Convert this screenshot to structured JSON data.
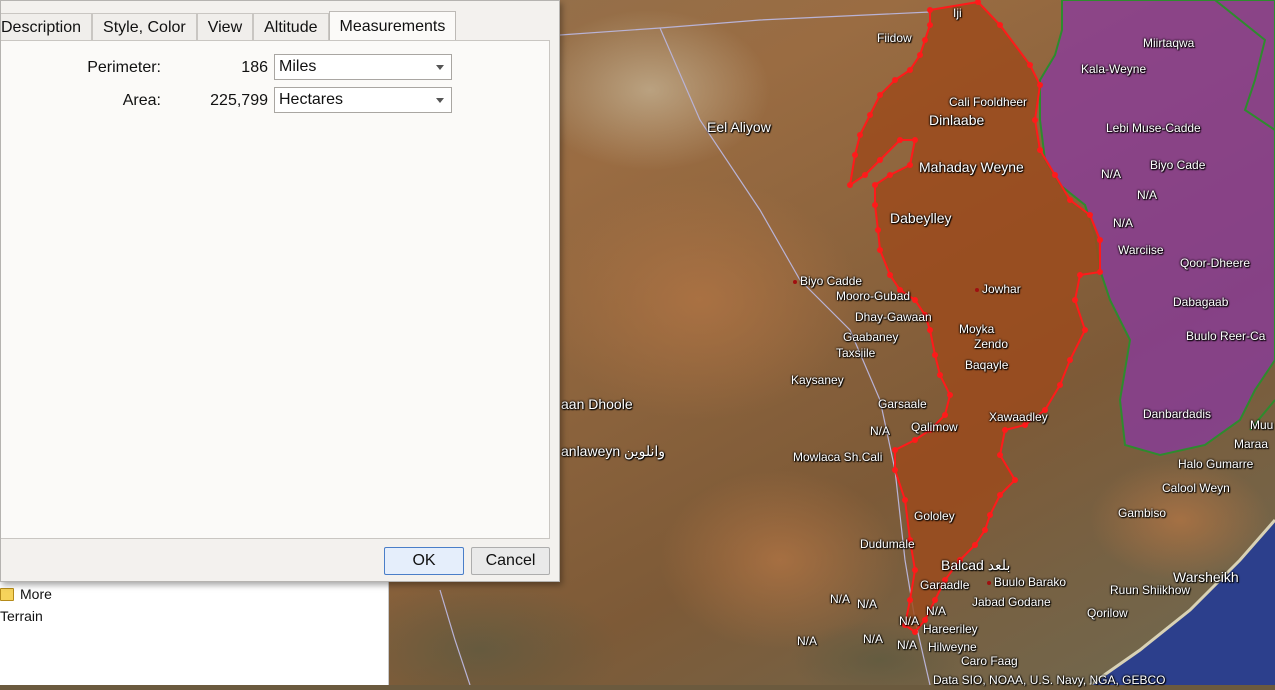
{
  "dialog": {
    "tabs": [
      {
        "label": "Description"
      },
      {
        "label": "Style, Color"
      },
      {
        "label": "View"
      },
      {
        "label": "Altitude"
      },
      {
        "label": "Measurements",
        "active": true
      }
    ],
    "measurements": {
      "perimeter": {
        "label": "Perimeter:",
        "value": "186",
        "unit": "Miles"
      },
      "area": {
        "label": "Area:",
        "value": "225,799",
        "unit": "Hectares"
      }
    },
    "ok_label": "OK",
    "cancel_label": "Cancel"
  },
  "sidebar": {
    "items": [
      {
        "label": "More",
        "icon": "folder-icon"
      },
      {
        "label": "Terrain"
      }
    ]
  },
  "map": {
    "colors": {
      "polygon_fill": "#9c4a1c",
      "polygon_stroke": "#ff1a1a",
      "region_fill": "#8a3aa0",
      "region_stroke": "#2e8b2e",
      "sea": "#2c3f8c"
    },
    "labels": {
      "iji": "Iji",
      "fiidow": "Fiidow",
      "eel_aliyow": "Eel Aliyow",
      "cali_fooldheer": "Cali Fooldheer",
      "dinlaabe": "Dinlaabe",
      "mahaday_weyne": "Mahaday Weyne",
      "dabeylley": "Dabeylley",
      "biyo_cadde_w": "Biyo Cadde",
      "mooro_gubad": "Mooro-Gubad",
      "dhay_gawaan": "Dhay-Gawaan",
      "gaabaney": "Gaabaney",
      "taxsiile": "Taxsiile",
      "jowhar": "Jowhar",
      "moyka": "Moyka",
      "zendo": "Zendo",
      "baqayle": "Baqayle",
      "kaysaney": "Kaysaney",
      "aan_dhoole": "aan Dhoole",
      "garsaale": "Garsaale",
      "na_1": "N/A",
      "qalimow": "Qalimow",
      "xawaadley": "Xawaadley",
      "anlaweyn": "anlaweyn وانلوين",
      "mowlaca": "Mowlaca Sh.Cali",
      "gololey": "Gololey",
      "dudumale": "Dudumale",
      "balcad": "Balcad بلعد",
      "garaadle": "Garaadle",
      "buulo_barako": "Buulo Barako",
      "jabad_godane": "Jabad Godane",
      "na_2": "N/A",
      "na_3": "N/A",
      "na_4": "N/A",
      "na_5": "N/A",
      "hareeriley": "Hareeriley",
      "na_6": "N/A",
      "na_7": "N/A",
      "na_8": "N/A",
      "hilweyne": "Hilweyne",
      "caro_faag": "Caro Faag",
      "miirtaqwa": "Miirtaqwa",
      "kala_weyne": "Kala-Weyne",
      "lebi_muse_cadde": "Lebi Muse-Cadde",
      "biyo_cade_e": "Biyo Cade",
      "na_9": "N/A",
      "na_10": "N/A",
      "na_11": "N/A",
      "warciise": "Warciise",
      "qoor_dheere": "Qoor-Dheere",
      "dabagaab": "Dabagaab",
      "buulo_reer_ca": "Buulo Reer-Ca",
      "danbardadis": "Danbardadis",
      "muu": "Muu",
      "maraa": "Maraa",
      "halo_gumarre": "Halo Gumarre",
      "calool_weyn": "Calool Weyn",
      "gambiso": "Gambiso",
      "warsheikh": "Warsheikh",
      "ruun_shiikhow": "Ruun Shiikhow",
      "qorilow": "Qorilow",
      "attribution": "Data SIO, NOAA, U.S. Navy, NGA, GEBCO"
    }
  }
}
